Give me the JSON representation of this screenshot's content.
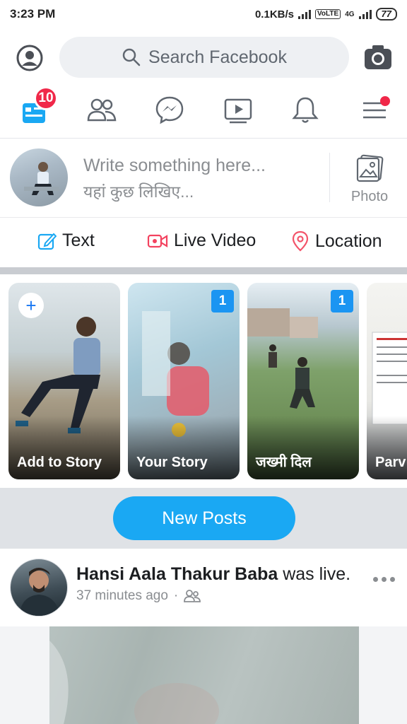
{
  "status_bar": {
    "time": "3:23 PM",
    "net_speed": "0.1KB/s",
    "lte": "VoLTE",
    "gen": "4G",
    "battery": "77"
  },
  "header": {
    "search_placeholder": "Search Facebook"
  },
  "nav": {
    "home_badge": "10"
  },
  "composer": {
    "prompt_en": "Write something here...",
    "prompt_hi": "यहां कुछ लिखिए...",
    "photo_label": "Photo"
  },
  "actions": [
    {
      "label": "Text"
    },
    {
      "label": "Live Video"
    },
    {
      "label": "Location"
    }
  ],
  "stories": [
    {
      "label": "Add to Story",
      "count": ""
    },
    {
      "label": "Your Story",
      "count": "1"
    },
    {
      "label": "जख्मी दिल",
      "count": "1"
    },
    {
      "label": "Parv Mehr",
      "count": ""
    }
  ],
  "new_posts_label": "New Posts",
  "post": {
    "author": "Hansi Aala Thakur Baba",
    "action": " was live.",
    "time": "37 minutes ago",
    "dot": "·"
  },
  "colors": {
    "accent": "#1877f2",
    "badge": "#f02849",
    "new_posts": "#1aa8f3"
  }
}
